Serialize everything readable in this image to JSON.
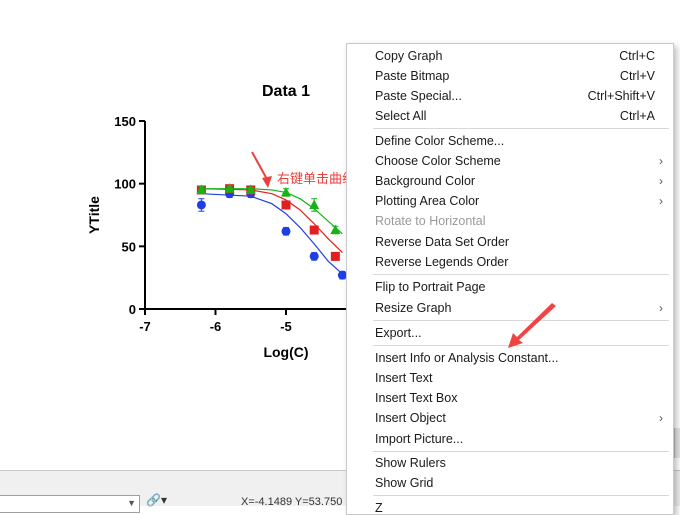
{
  "annotation": {
    "text": "右键单击曲线"
  },
  "chart_data": {
    "type": "scatter",
    "title": "Data 1",
    "xlabel": "Log(C)",
    "ylabel": "YTitle",
    "xlim": [
      -7,
      -4
    ],
    "ylim": [
      0,
      150
    ],
    "xticks": [
      -7,
      -6,
      -5
    ],
    "yticks": [
      0,
      50,
      100,
      150
    ],
    "series": [
      {
        "color": "#1f3fe6",
        "marker": "circle",
        "x": [
          -6.2,
          -5.8,
          -5.5,
          -5.0,
          -4.6,
          -4.2
        ],
        "y": [
          83,
          92,
          92,
          62,
          42,
          27
        ],
        "err": [
          5,
          3,
          3,
          3,
          3,
          3
        ],
        "fit": [
          [
            -6.2,
            92
          ],
          [
            -5.5,
            90
          ],
          [
            -5.2,
            84
          ],
          [
            -5.0,
            76
          ],
          [
            -4.8,
            65
          ],
          [
            -4.6,
            52
          ],
          [
            -4.4,
            38
          ],
          [
            -4.2,
            28
          ]
        ]
      },
      {
        "color": "#e11f1f",
        "marker": "square",
        "x": [
          -6.2,
          -5.8,
          -5.5,
          -5.0,
          -4.6,
          -4.3
        ],
        "y": [
          95,
          96,
          95,
          83,
          63,
          42
        ],
        "err": [
          3,
          2,
          2,
          3,
          3,
          3
        ],
        "fit": [
          [
            -6.2,
            96
          ],
          [
            -5.5,
            95
          ],
          [
            -5.2,
            92
          ],
          [
            -5.0,
            87
          ],
          [
            -4.8,
            79
          ],
          [
            -4.6,
            68
          ],
          [
            -4.4,
            56
          ],
          [
            -4.2,
            45
          ]
        ]
      },
      {
        "color": "#16b316",
        "marker": "triangle",
        "x": [
          -6.2,
          -5.8,
          -5.5,
          -5.0,
          -4.6,
          -4.3
        ],
        "y": [
          95,
          96,
          95,
          93,
          83,
          63
        ],
        "err": [
          3,
          2,
          2,
          3,
          5,
          3
        ],
        "fit": [
          [
            -6.2,
            96
          ],
          [
            -5.5,
            96
          ],
          [
            -5.2,
            95
          ],
          [
            -5.0,
            93
          ],
          [
            -4.8,
            88
          ],
          [
            -4.6,
            80
          ],
          [
            -4.4,
            70
          ],
          [
            -4.2,
            60
          ]
        ]
      }
    ]
  },
  "status": {
    "coords": "X=-4.1489 Y=53.750"
  },
  "context_menu": {
    "items": [
      {
        "label": "Copy Graph",
        "shortcut": "Ctrl+C"
      },
      {
        "label": "Paste Bitmap",
        "shortcut": "Ctrl+V"
      },
      {
        "label": "Paste Special...",
        "shortcut": "Ctrl+Shift+V"
      },
      {
        "label": "Select All",
        "shortcut": "Ctrl+A"
      },
      {
        "label": "Define Color Scheme..."
      },
      {
        "label": "Choose Color Scheme"
      },
      {
        "label": "Background Color"
      },
      {
        "label": "Plotting Area Color"
      },
      {
        "label": "Rotate to Horizontal"
      },
      {
        "label": "Reverse Data Set Order"
      },
      {
        "label": "Reverse Legends Order"
      },
      {
        "label": "Flip to Portrait Page"
      },
      {
        "label": "Resize Graph"
      },
      {
        "label": "Export..."
      },
      {
        "label": "Insert Info or Analysis Constant..."
      },
      {
        "label": "Insert Text"
      },
      {
        "label": "Insert Text Box"
      },
      {
        "label": "Insert Object"
      },
      {
        "label": "Import Picture..."
      },
      {
        "label": "Show Rulers"
      },
      {
        "label": "Show Grid"
      },
      {
        "label": "Z"
      }
    ]
  }
}
